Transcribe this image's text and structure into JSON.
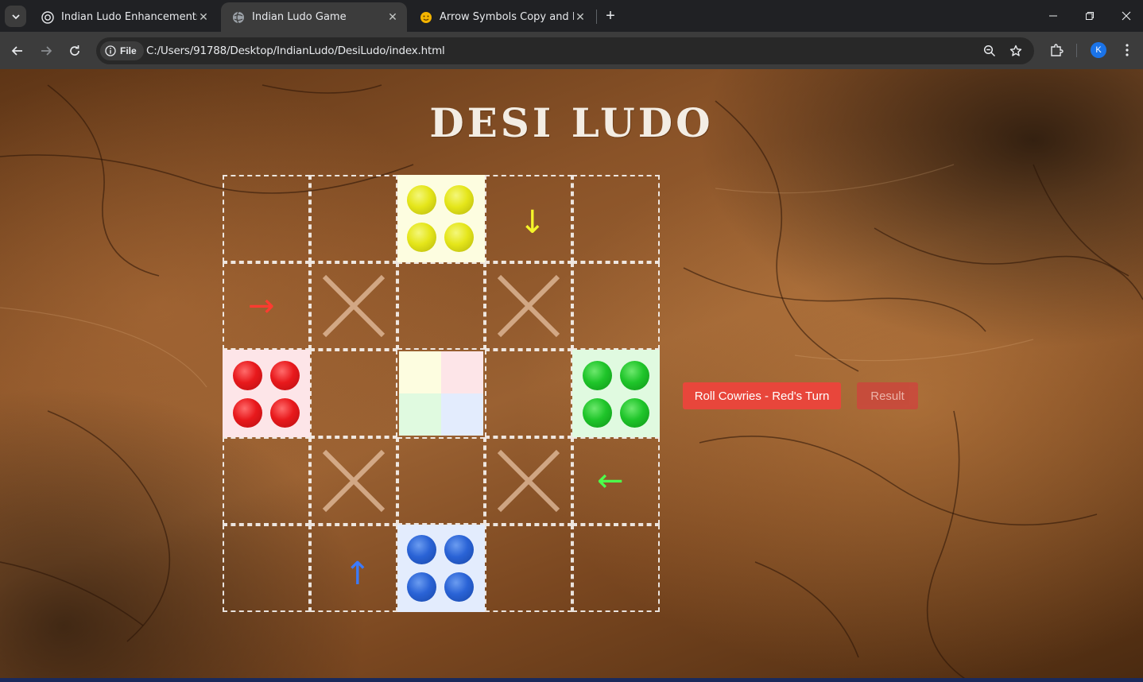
{
  "browser": {
    "tabs": [
      {
        "title": "Indian Ludo Enhancements",
        "icon": "openai-icon",
        "active": false
      },
      {
        "title": "Indian Ludo Game",
        "icon": "globe-icon",
        "active": true
      },
      {
        "title": "Arrow Symbols Copy and Paste",
        "icon": "emoji-icon",
        "active": false
      }
    ],
    "close_glyph": "✕",
    "new_tab_glyph": "+",
    "address": {
      "chip_label": "File",
      "url": "C:/Users/91788/Desktop/IndianLudo/DesiLudo/index.html"
    },
    "profile_initial": "K"
  },
  "game": {
    "title": "DESI LUDO",
    "roll_button": "Roll Cowries - Red's Turn",
    "result_button": "Result",
    "arrows": {
      "yellow": {
        "glyph": "↓",
        "color": "#f5f52a"
      },
      "red": {
        "glyph": "→",
        "color": "#ff3b30"
      },
      "green": {
        "glyph": "←",
        "color": "#4cff4c"
      },
      "blue": {
        "glyph": "↑",
        "color": "#3b7bff"
      }
    },
    "colors": {
      "yellow_home": "#fdfde0",
      "red_home": "#fde5e8",
      "green_home": "#e0fae0",
      "blue_home": "#e3ecfd",
      "roll_button": "#e8463b",
      "result_button": "#c84b3c"
    },
    "tokens_per_player": 4
  }
}
